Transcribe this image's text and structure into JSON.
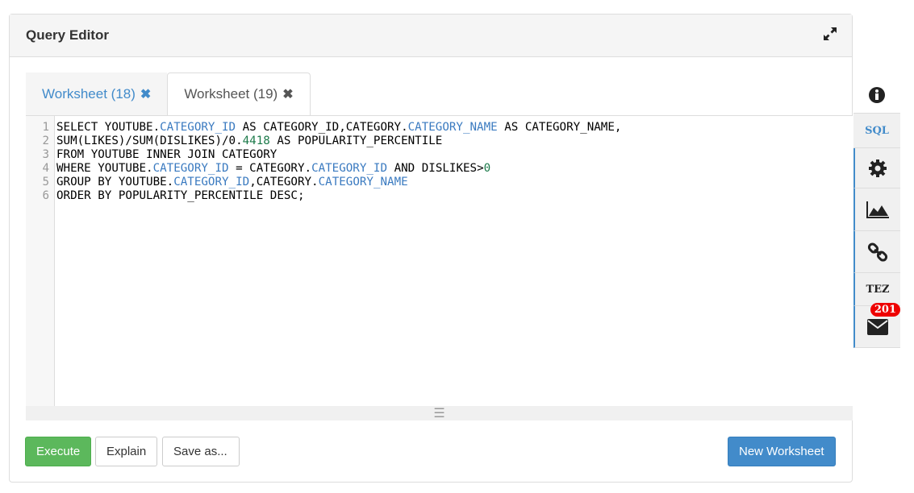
{
  "header": {
    "title": "Query Editor",
    "expand_icon": "expand-icon"
  },
  "tabs": [
    {
      "label": "Worksheet (18)",
      "active": false
    },
    {
      "label": "Worksheet (19)",
      "active": true
    }
  ],
  "editor": {
    "lines": [
      [
        [
          "SELECT YOUTUBE.",
          ""
        ],
        [
          "CATEGORY_ID",
          "kw"
        ],
        [
          " AS CATEGORY_ID,CATEGORY.",
          ""
        ],
        [
          "CATEGORY_NAME",
          "kw"
        ],
        [
          " AS CATEGORY_NAME,",
          ""
        ]
      ],
      [
        [
          "SUM(LIKES)/SUM(DISLIKES)/0.",
          ""
        ],
        [
          "4418",
          "num"
        ],
        [
          " AS POPULARITY_PERCENTILE",
          ""
        ]
      ],
      [
        [
          "FROM YOUTUBE INNER JOIN CATEGORY",
          ""
        ]
      ],
      [
        [
          "WHERE YOUTUBE.",
          ""
        ],
        [
          "CATEGORY_ID",
          "kw"
        ],
        [
          " = CATEGORY.",
          ""
        ],
        [
          "CATEGORY_ID",
          "kw"
        ],
        [
          " AND DISLIKES>",
          ""
        ],
        [
          "0",
          "num"
        ]
      ],
      [
        [
          "GROUP BY YOUTUBE.",
          ""
        ],
        [
          "CATEGORY_ID",
          "kw"
        ],
        [
          ",CATEGORY.",
          ""
        ],
        [
          "CATEGORY_NAME",
          "kw"
        ]
      ],
      [
        [
          "ORDER BY POPULARITY_PERCENTILE DESC;",
          ""
        ]
      ]
    ]
  },
  "buttons": {
    "execute": "Execute",
    "explain": "Explain",
    "save_as": "Save as...",
    "new_worksheet": "New Worksheet"
  },
  "sidebar": {
    "sql": "SQL",
    "tez": "TEZ",
    "mail_count": "201"
  },
  "colors": {
    "execute": "#5cb85c",
    "primary": "#428bca"
  }
}
